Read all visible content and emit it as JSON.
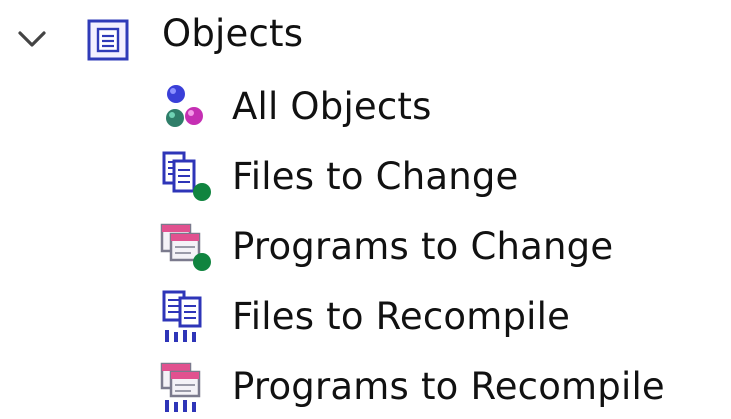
{
  "tree": {
    "root": {
      "label": "Objects",
      "expanded": true,
      "icon": "objects-folder-icon"
    },
    "items": [
      {
        "label": "All Objects",
        "icon": "all-objects-icon"
      },
      {
        "label": "Files to Change",
        "icon": "files-change-icon"
      },
      {
        "label": "Programs to Change",
        "icon": "programs-change-icon"
      },
      {
        "label": "Files to Recompile",
        "icon": "files-recompile-icon"
      },
      {
        "label": "Programs to Recompile",
        "icon": "programs-recompile-icon"
      }
    ]
  }
}
